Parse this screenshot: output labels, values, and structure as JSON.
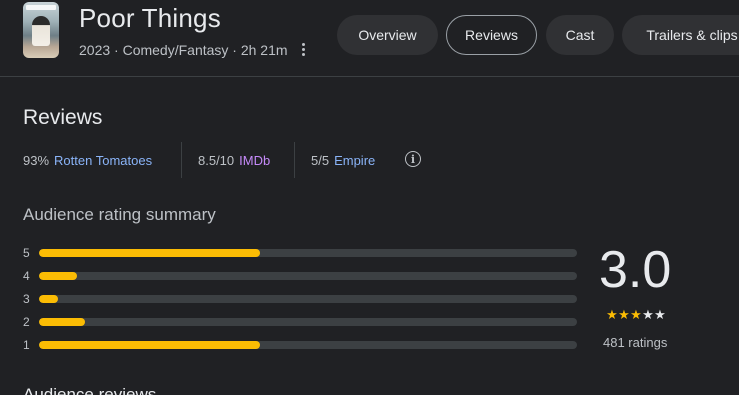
{
  "movie": {
    "title": "Poor Things",
    "meta": "2023 · Comedy/Fantasy · 2h 21m"
  },
  "tabs": [
    {
      "label": "Overview",
      "active": false
    },
    {
      "label": "Reviews",
      "active": true
    },
    {
      "label": "Cast",
      "active": false
    },
    {
      "label": "Trailers & clips",
      "active": false
    }
  ],
  "reviews": {
    "heading": "Reviews",
    "scores": [
      {
        "value": "93%",
        "source": "Rotten Tomatoes",
        "color": "#8ab4f8"
      },
      {
        "value": "8.5/10",
        "source": "IMDb",
        "color": "#c58af9"
      },
      {
        "value": "5/5",
        "source": "Empire",
        "color": "#8ab4f8"
      }
    ],
    "info_icon": "info-icon"
  },
  "summary": {
    "heading": "Audience rating summary",
    "bars": [
      {
        "label": "5",
        "fraction": 0.41
      },
      {
        "label": "4",
        "fraction": 0.07
      },
      {
        "label": "3",
        "fraction": 0.035
      },
      {
        "label": "2",
        "fraction": 0.085
      },
      {
        "label": "1",
        "fraction": 0.41
      }
    ],
    "rating": "3.0",
    "stars_filled": 3,
    "stars_total": 5,
    "ratings_count": "481 ratings"
  },
  "audience_reviews": {
    "heading": "Audience reviews"
  },
  "colors": {
    "background": "#202124",
    "bar_fill": "#fbbc04",
    "bar_track": "#3c4043",
    "tab_bg": "#303134"
  }
}
